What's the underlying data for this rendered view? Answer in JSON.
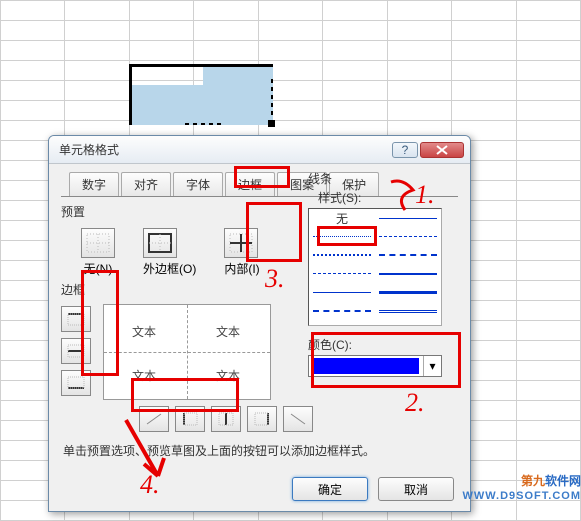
{
  "dialog": {
    "title": "单元格格式",
    "tabs": [
      "数字",
      "对齐",
      "字体",
      "边框",
      "图案",
      "保护"
    ],
    "active_tab": "边框",
    "preset_label": "预置",
    "presets": {
      "none": "无(N)",
      "outline": "外边框(O)",
      "inside": "内部(I)"
    },
    "border_label": "边框",
    "preview_text": "文本",
    "lines_label": "线条",
    "style_label": "样式(S):",
    "style_none": "无",
    "color_label": "颜色(C):",
    "color_value": "#0000ff",
    "hint": "单击预置选项、预览草图及上面的按钮可以添加边框样式。",
    "ok": "确定",
    "cancel": "取消"
  },
  "annotations": {
    "n1": "1.",
    "n2": "2.",
    "n3": "3.",
    "n4": "4."
  },
  "watermark": {
    "line1a": "第九",
    "line1b": "软件网",
    "line2": "WWW.D9SOFT.COM"
  }
}
